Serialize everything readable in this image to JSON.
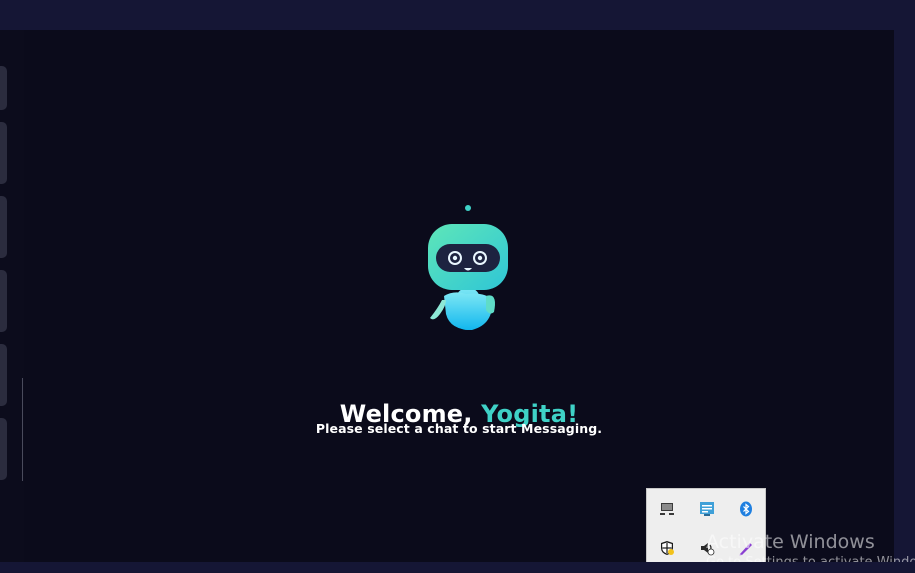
{
  "welcome": {
    "greeting": "Welcome,",
    "name": "Yogita!",
    "subtitle": "Please select a chat to start Messaging."
  },
  "colors": {
    "background": "#0b0b1b",
    "frame": "#151635",
    "accent": "#3fd2c7"
  },
  "tray": {
    "icons": [
      "display-icon",
      "network-icon",
      "bluetooth-icon",
      "windows-security-icon",
      "speaker-icon",
      "pen-icon"
    ]
  },
  "watermark": {
    "title": "Activate Windows",
    "subtitle": "Go to Settings to activate Windows."
  }
}
